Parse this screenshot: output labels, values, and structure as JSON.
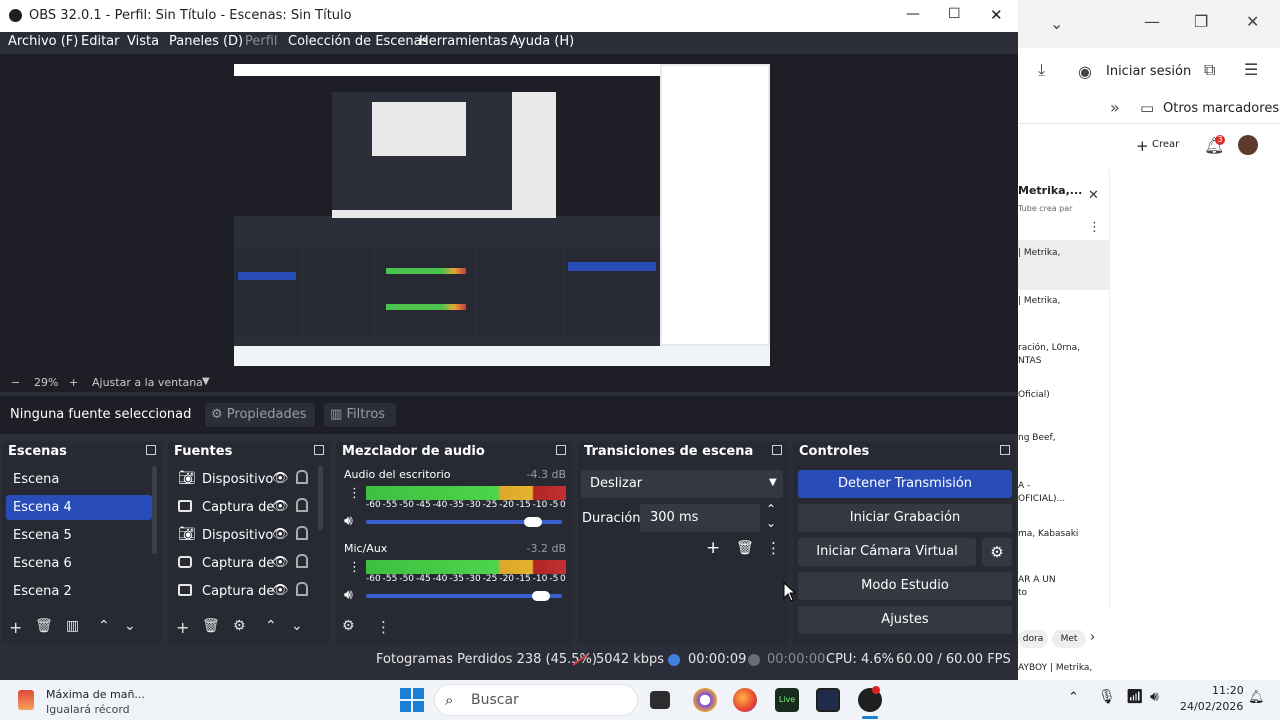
{
  "obs": {
    "window_title": "OBS 32.0.1 - Perfil: Sin Título - Escenas: Sin Título",
    "menu": [
      "Archivo (F)",
      "Editar",
      "Vista",
      "Paneles (D)",
      "Perfil",
      "Colección de Escenas",
      "Herramientas",
      "Ayuda (H)"
    ],
    "zoom": {
      "minus": "−",
      "value": "29%",
      "plus": "+",
      "fit_label": "Ajustar a la ventana"
    },
    "source_toolbar": {
      "no_source": "Ninguna fuente seleccionad",
      "properties": "Propiedades",
      "filters": "Filtros"
    },
    "scenes": {
      "title": "Escenas",
      "items": [
        "Escena",
        "Escena 4",
        "Escena 5",
        "Escena 6",
        "Escena 2"
      ],
      "selected_index": 1
    },
    "sources": {
      "title": "Fuentes",
      "items": [
        {
          "label": "Dispositivo",
          "icon": "camera-icon"
        },
        {
          "label": "Captura de",
          "icon": "window-icon"
        },
        {
          "label": "Dispositivo",
          "icon": "camera-icon"
        },
        {
          "label": "Captura de",
          "icon": "monitor-icon"
        },
        {
          "label": "Captura de",
          "icon": "window-icon"
        }
      ]
    },
    "mixer": {
      "title": "Mezclador de audio",
      "channels": [
        {
          "name": "Audio del escritorio",
          "db": "-4.3 dB",
          "volume": 0.9
        },
        {
          "name": "Mic/Aux",
          "db": "-3.2 dB",
          "volume": 0.94
        }
      ],
      "scale": [
        "-60",
        "-55",
        "-50",
        "-45",
        "-40",
        "-35",
        "-30",
        "-25",
        "-20",
        "-15",
        "-10",
        "-5",
        "0"
      ]
    },
    "transitions": {
      "title": "Transiciones de escena",
      "selected": "Deslizar",
      "duration_label": "Duración",
      "duration_value": "300 ms"
    },
    "controls": {
      "title": "Controles",
      "stop_stream": "Detener Transmisión",
      "start_recording": "Iniciar Grabación",
      "start_virtual_cam": "Iniciar Cámara Virtual",
      "studio_mode": "Modo Estudio",
      "settings": "Ajustes"
    },
    "status": {
      "dropped": "Fotogramas Perdidos 238 (45.5%)",
      "bitrate": "5042 kbps",
      "stream_time": "00:00:09",
      "rec_time": "00:00:00",
      "cpu": "CPU: 4.6%",
      "fps": "60.00 / 60.00 FPS"
    },
    "colors": {
      "accent": "#284cb8",
      "panel": "#272a33",
      "bg": "#1e1f26"
    }
  },
  "browser": {
    "sign_in": "Iniciar sesión",
    "bookmarks_folder": "Otros marcadores",
    "create": "Crear",
    "notification_count": "3",
    "side_items": [
      "Metrika,...",
      "Tube crea par",
      "| Metrika,",
      "| Metrika,",
      "ración, L0rna,",
      "NTAS",
      "Oficial)",
      "ng Beef,",
      "A -",
      "OFICIAL)...",
      "ma, Kabasaki",
      "AR A UN",
      "to"
    ],
    "chips": [
      "dora",
      "Met"
    ],
    "bottom_item": "AYBOY | Metrika,"
  },
  "taskbar": {
    "news_title": "Máxima de mañ...",
    "news_sub": "Igualará récord",
    "search_placeholder": "Buscar",
    "time": "11:20",
    "date": "24/02/2026",
    "app_live": "Live"
  }
}
